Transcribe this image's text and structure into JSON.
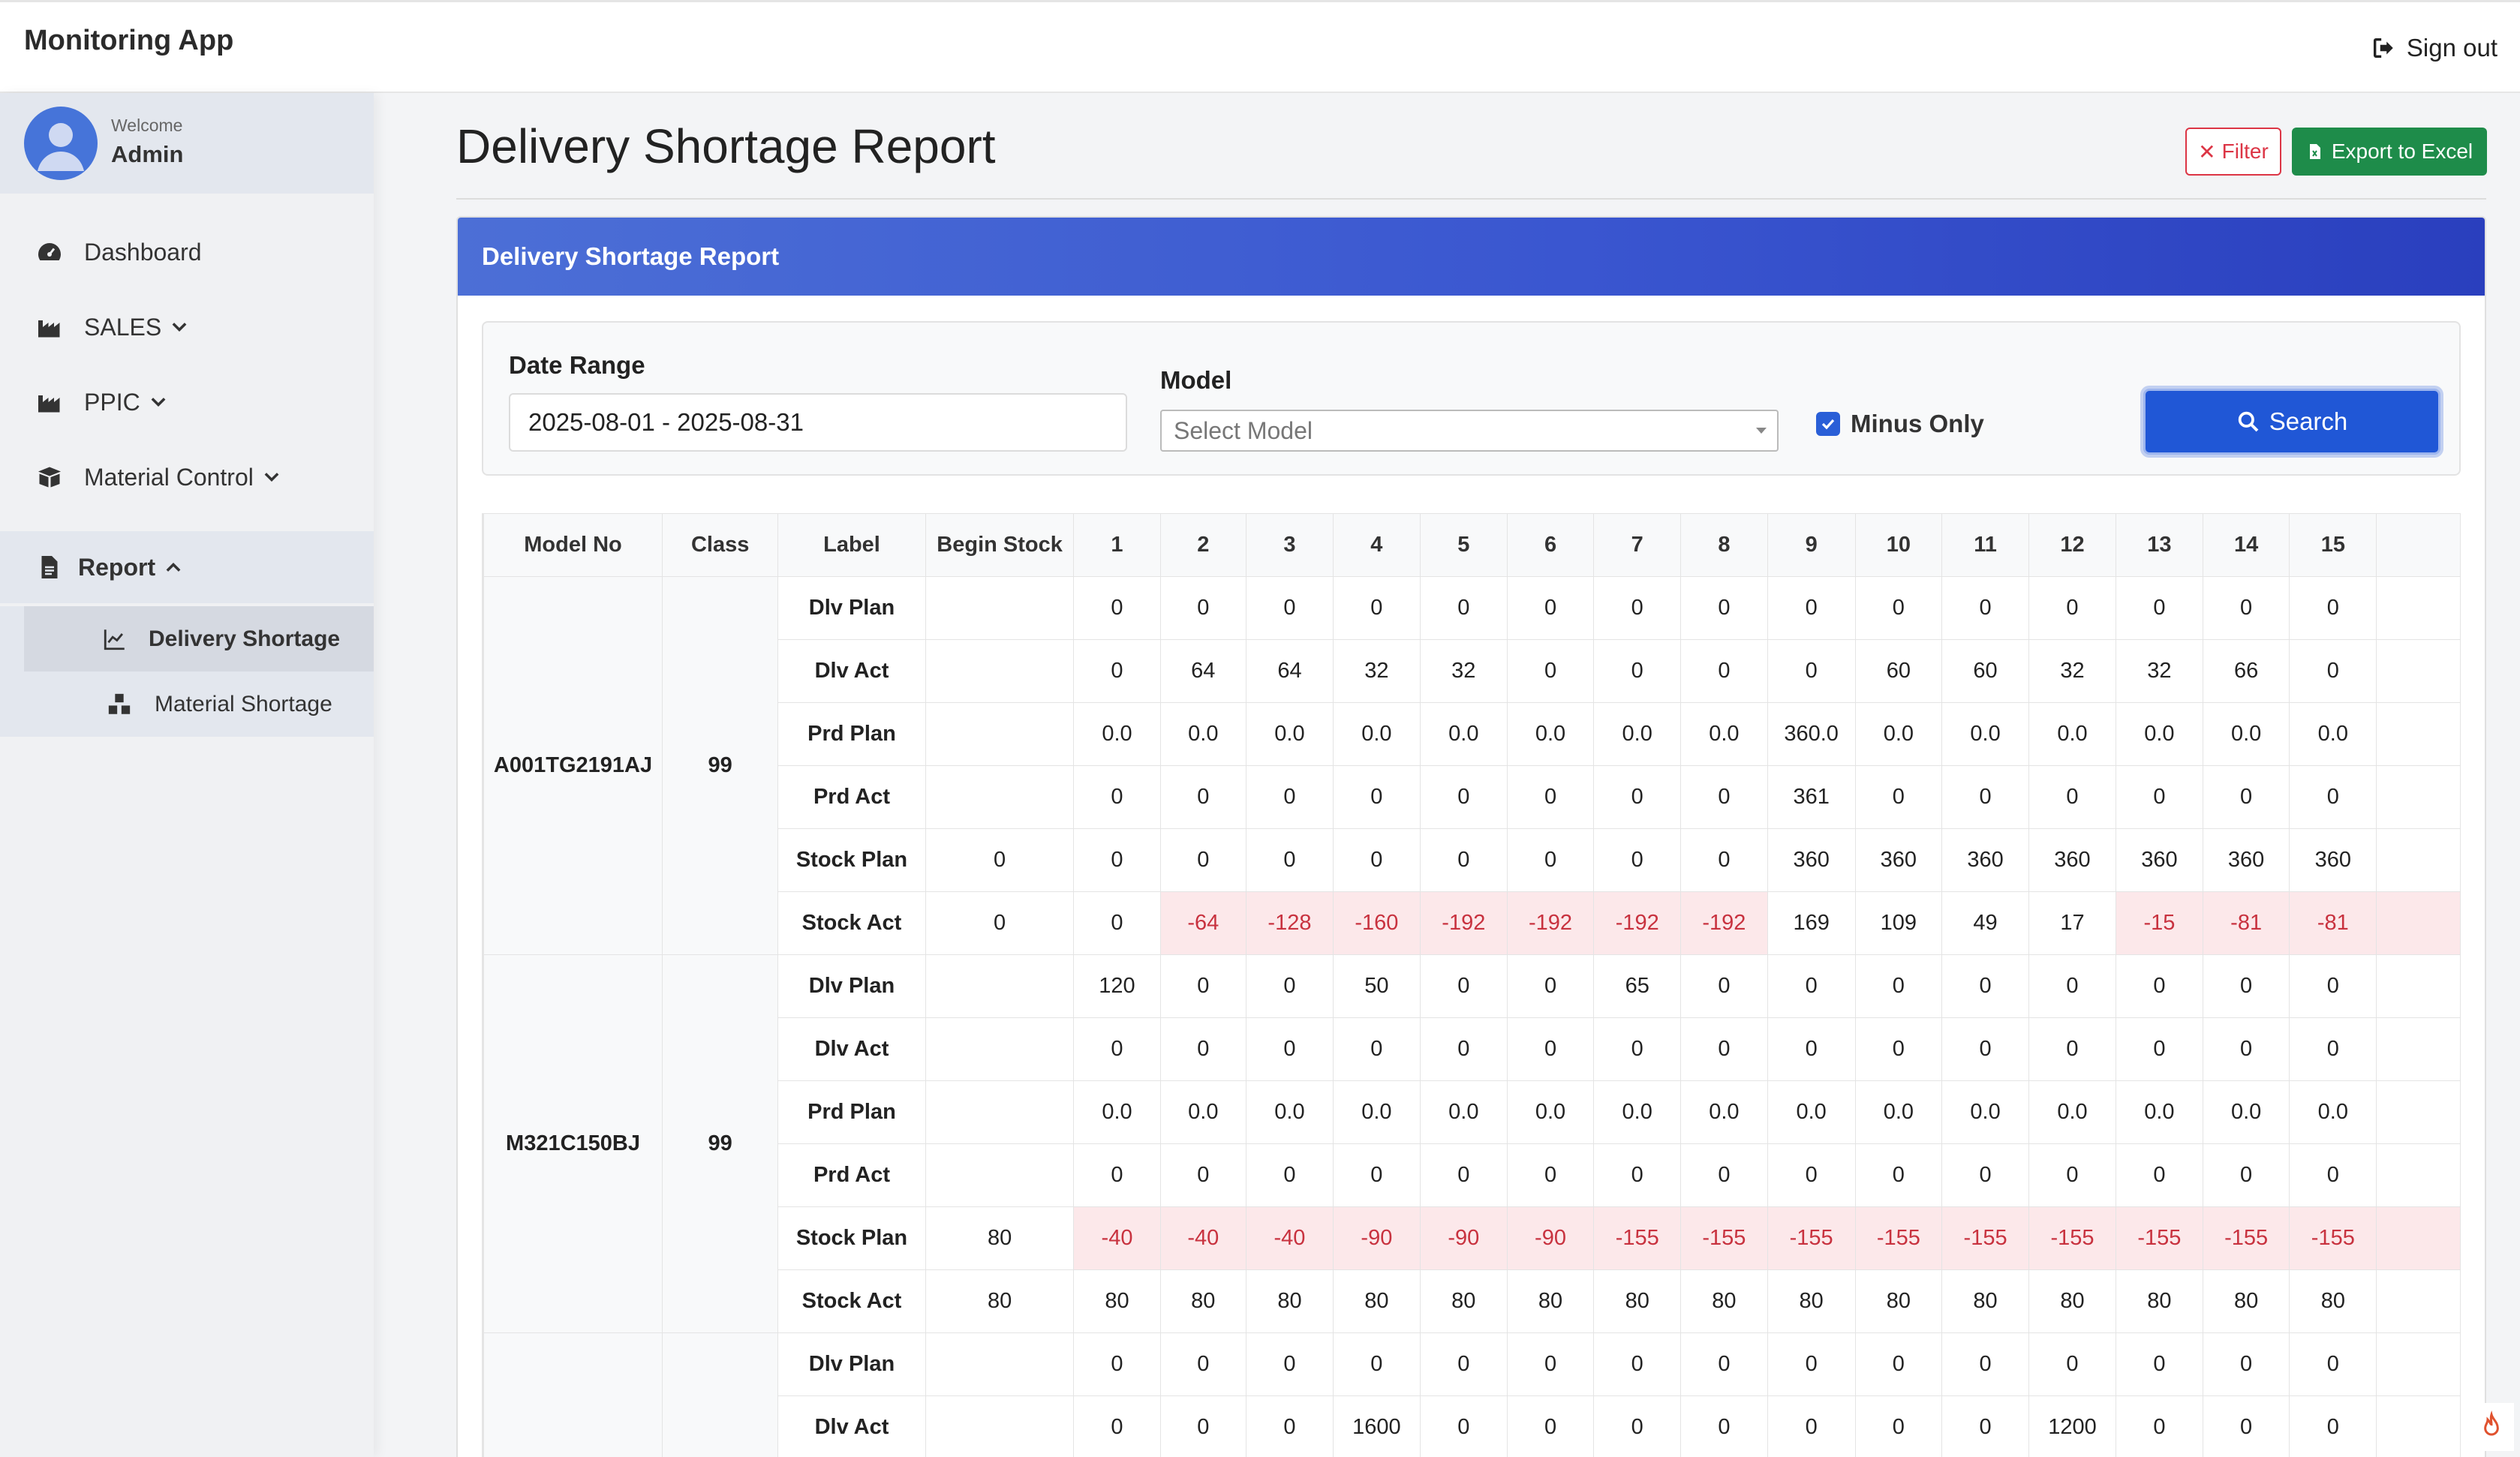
{
  "app": {
    "title": "Monitoring App",
    "sign_out": "Sign out"
  },
  "user": {
    "welcome": "Welcome",
    "name": "Admin"
  },
  "sidebar": {
    "items": [
      {
        "label": "Dashboard",
        "icon": "gauge-icon"
      },
      {
        "label": "SALES",
        "icon": "industry-icon"
      },
      {
        "label": "PPIC",
        "icon": "industry-icon"
      },
      {
        "label": "Material Control",
        "icon": "box-icon"
      },
      {
        "label": "Report",
        "icon": "file-icon"
      }
    ],
    "sub_items": [
      {
        "label": "Delivery Shortage",
        "icon": "line-chart-icon"
      },
      {
        "label": "Material Shortage",
        "icon": "cubes-icon"
      }
    ]
  },
  "page": {
    "title": "Delivery Shortage Report",
    "filter_btn": "Filter",
    "export_btn": "Export to Excel",
    "card_title": "Delivery Shortage Report"
  },
  "filters": {
    "date_range_label": "Date Range",
    "date_range_value": "2025-08-01 - 2025-08-31",
    "model_label": "Model",
    "model_placeholder": "Select Model",
    "minus_only_label": "Minus Only",
    "minus_only_checked": true,
    "search_btn": "Search"
  },
  "colors": {
    "accent": "#2057d6",
    "header_gradient_start": "#4c6fd6",
    "header_gradient_end": "#2a3fbe",
    "export_green": "#1e8c4a",
    "danger": "#dc3545",
    "negative_bg": "#fce8ea",
    "negative_text": "#c8323f"
  },
  "table": {
    "headers": [
      "Model No",
      "Class",
      "Label",
      "Begin Stock",
      "1",
      "2",
      "3",
      "4",
      "5",
      "6",
      "7",
      "8",
      "9",
      "10",
      "11",
      "12",
      "13",
      "14",
      "15"
    ],
    "groups": [
      {
        "model": "A001TG2191AJ",
        "class": "99",
        "rows": [
          {
            "label": "Dlv Plan",
            "begin": "",
            "values": [
              "0",
              "0",
              "0",
              "0",
              "0",
              "0",
              "0",
              "0",
              "0",
              "0",
              "0",
              "0",
              "0",
              "0",
              "0"
            ]
          },
          {
            "label": "Dlv Act",
            "begin": "",
            "values": [
              "0",
              "64",
              "64",
              "32",
              "32",
              "0",
              "0",
              "0",
              "0",
              "60",
              "60",
              "32",
              "32",
              "66",
              "0"
            ]
          },
          {
            "label": "Prd Plan",
            "begin": "",
            "values": [
              "0.0",
              "0.0",
              "0.0",
              "0.0",
              "0.0",
              "0.0",
              "0.0",
              "0.0",
              "360.0",
              "0.0",
              "0.0",
              "0.0",
              "0.0",
              "0.0",
              "0.0"
            ]
          },
          {
            "label": "Prd Act",
            "begin": "",
            "values": [
              "0",
              "0",
              "0",
              "0",
              "0",
              "0",
              "0",
              "0",
              "361",
              "0",
              "0",
              "0",
              "0",
              "0",
              "0"
            ]
          },
          {
            "label": "Stock Plan",
            "begin": "0",
            "values": [
              "0",
              "0",
              "0",
              "0",
              "0",
              "0",
              "0",
              "0",
              "360",
              "360",
              "360",
              "360",
              "360",
              "360",
              "360"
            ]
          },
          {
            "label": "Stock Act",
            "begin": "0",
            "values": [
              "0",
              "-64",
              "-128",
              "-160",
              "-192",
              "-192",
              "-192",
              "-192",
              "169",
              "109",
              "49",
              "17",
              "-15",
              "-81",
              "-81"
            ]
          }
        ]
      },
      {
        "model": "M321C150BJ",
        "class": "99",
        "rows": [
          {
            "label": "Dlv Plan",
            "begin": "",
            "values": [
              "120",
              "0",
              "0",
              "50",
              "0",
              "0",
              "65",
              "0",
              "0",
              "0",
              "0",
              "0",
              "0",
              "0",
              "0"
            ]
          },
          {
            "label": "Dlv Act",
            "begin": "",
            "values": [
              "0",
              "0",
              "0",
              "0",
              "0",
              "0",
              "0",
              "0",
              "0",
              "0",
              "0",
              "0",
              "0",
              "0",
              "0"
            ]
          },
          {
            "label": "Prd Plan",
            "begin": "",
            "values": [
              "0.0",
              "0.0",
              "0.0",
              "0.0",
              "0.0",
              "0.0",
              "0.0",
              "0.0",
              "0.0",
              "0.0",
              "0.0",
              "0.0",
              "0.0",
              "0.0",
              "0.0"
            ]
          },
          {
            "label": "Prd Act",
            "begin": "",
            "values": [
              "0",
              "0",
              "0",
              "0",
              "0",
              "0",
              "0",
              "0",
              "0",
              "0",
              "0",
              "0",
              "0",
              "0",
              "0"
            ]
          },
          {
            "label": "Stock Plan",
            "begin": "80",
            "values": [
              "-40",
              "-40",
              "-40",
              "-90",
              "-90",
              "-90",
              "-155",
              "-155",
              "-155",
              "-155",
              "-155",
              "-155",
              "-155",
              "-155",
              "-155"
            ]
          },
          {
            "label": "Stock Act",
            "begin": "80",
            "values": [
              "80",
              "80",
              "80",
              "80",
              "80",
              "80",
              "80",
              "80",
              "80",
              "80",
              "80",
              "80",
              "80",
              "80",
              "80"
            ]
          }
        ]
      },
      {
        "model": "",
        "class": "",
        "rows": [
          {
            "label": "Dlv Plan",
            "begin": "",
            "values": [
              "0",
              "0",
              "0",
              "0",
              "0",
              "0",
              "0",
              "0",
              "0",
              "0",
              "0",
              "0",
              "0",
              "0",
              "0"
            ]
          },
          {
            "label": "Dlv Act",
            "begin": "",
            "values": [
              "0",
              "0",
              "0",
              "1600",
              "0",
              "0",
              "0",
              "0",
              "0",
              "0",
              "0",
              "1200",
              "0",
              "0",
              "0"
            ]
          }
        ]
      }
    ]
  }
}
